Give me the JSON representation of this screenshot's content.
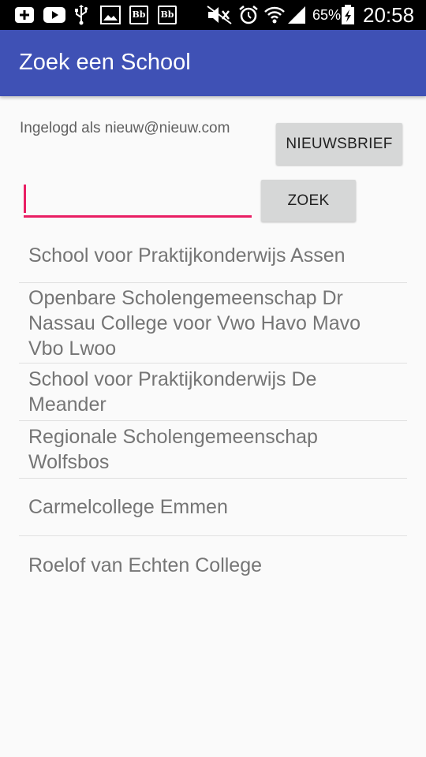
{
  "status_bar": {
    "icons": [
      "add-box-icon",
      "youtube-icon",
      "usb-icon",
      "image-icon",
      "bb-icon",
      "bb-icon",
      "mute-icon",
      "alarm-icon",
      "wifi-icon",
      "signal-icon",
      "battery-charging-icon"
    ],
    "bb_label": "Bb",
    "battery_percent": "65%",
    "time": "20:58"
  },
  "app_bar": {
    "title": "Zoek een School",
    "color": "#3f51b5"
  },
  "login": {
    "label": "Ingelogd als nieuw@nieuw.com"
  },
  "buttons": {
    "newsletter": "NIEUWSBRIEF",
    "search": "ZOEK"
  },
  "search": {
    "value": "",
    "accent_color": "#e91e63"
  },
  "schools": [
    "School voor Praktijkonderwijs Assen",
    "Openbare Scholengemeenschap Dr Nassau College voor Vwo Havo Mavo Vbo Lwoo",
    "School voor Praktijkonderwijs De Meander",
    "Regionale Scholengemeenschap Wolfsbos",
    "Carmelcollege Emmen",
    "Roelof van Echten College"
  ]
}
